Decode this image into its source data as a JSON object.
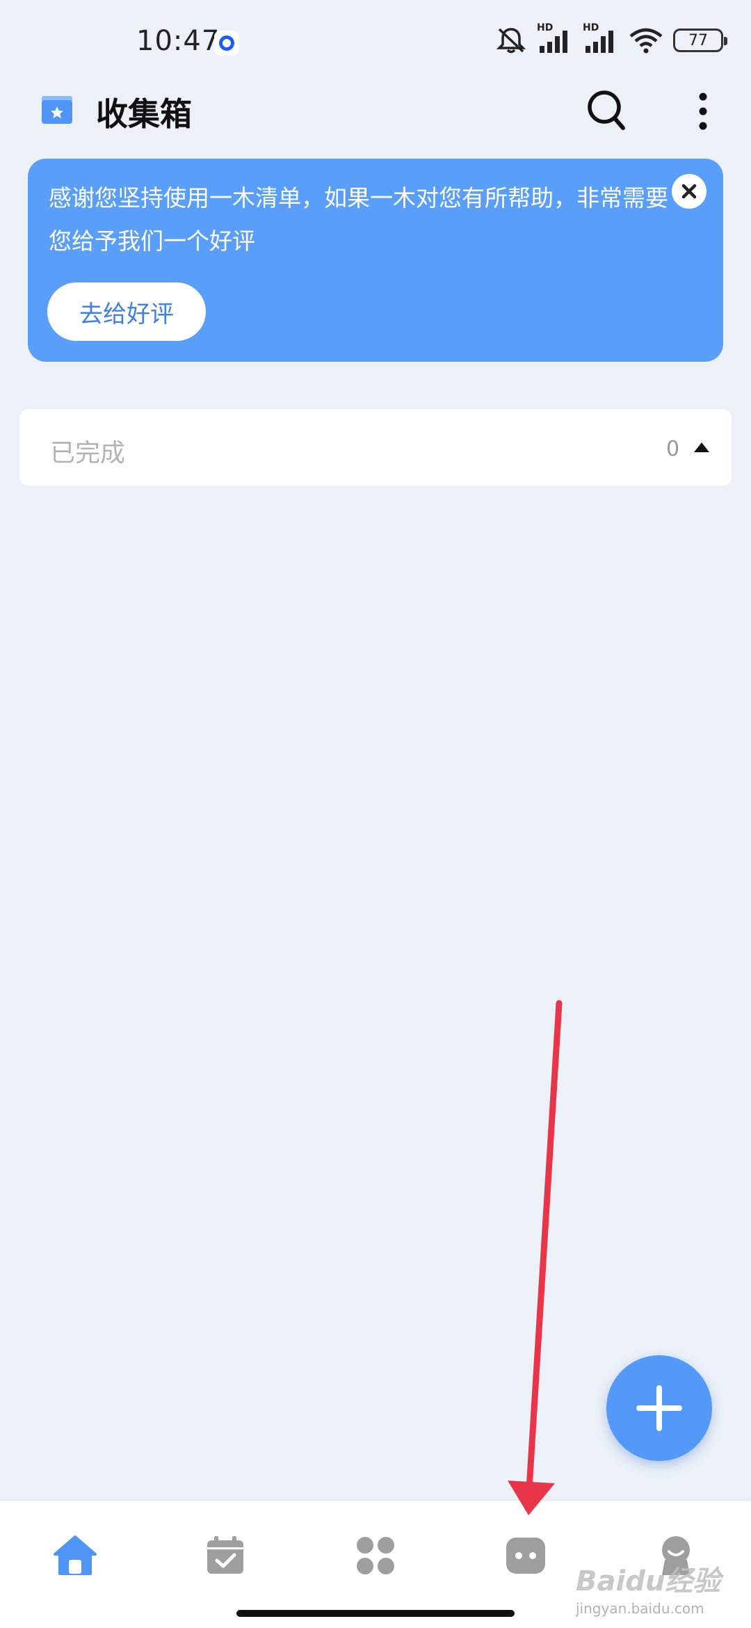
{
  "status_bar": {
    "time": "10:47",
    "signal_label_1": "HD",
    "signal_label_2": "HD",
    "battery": "77",
    "icons": [
      "app-notification-icon",
      "mute-icon",
      "signal-icon",
      "wifi-icon",
      "battery-icon"
    ]
  },
  "header": {
    "title": "收集箱",
    "icons": [
      "inbox-folder-icon",
      "search-icon",
      "more-vertical-icon"
    ]
  },
  "banner": {
    "message": "感谢您坚持使用一木清单，如果一木对您有所帮助，非常需要您给予我们一个好评",
    "button_label": "去给好评",
    "close_icon": "close-icon"
  },
  "completed": {
    "label": "已完成",
    "count": "0",
    "toggle_icon": "triangle-up-icon"
  },
  "fab": {
    "icon": "plus-icon"
  },
  "bottom_nav": {
    "items": [
      {
        "icon": "home-icon",
        "active": true
      },
      {
        "icon": "calendar-check-icon",
        "active": false
      },
      {
        "icon": "apps-grid-icon",
        "active": false
      },
      {
        "icon": "chat-dots-icon",
        "active": false
      },
      {
        "icon": "profile-icon",
        "active": false
      }
    ]
  },
  "watermark": {
    "brand": "Baidu经验",
    "site": "jingyan.baidu.com"
  },
  "colors": {
    "accent": "#599ef9",
    "background": "#ecf1f8",
    "nav_inactive": "#9e9e9e",
    "annotation": "#e8354a"
  }
}
